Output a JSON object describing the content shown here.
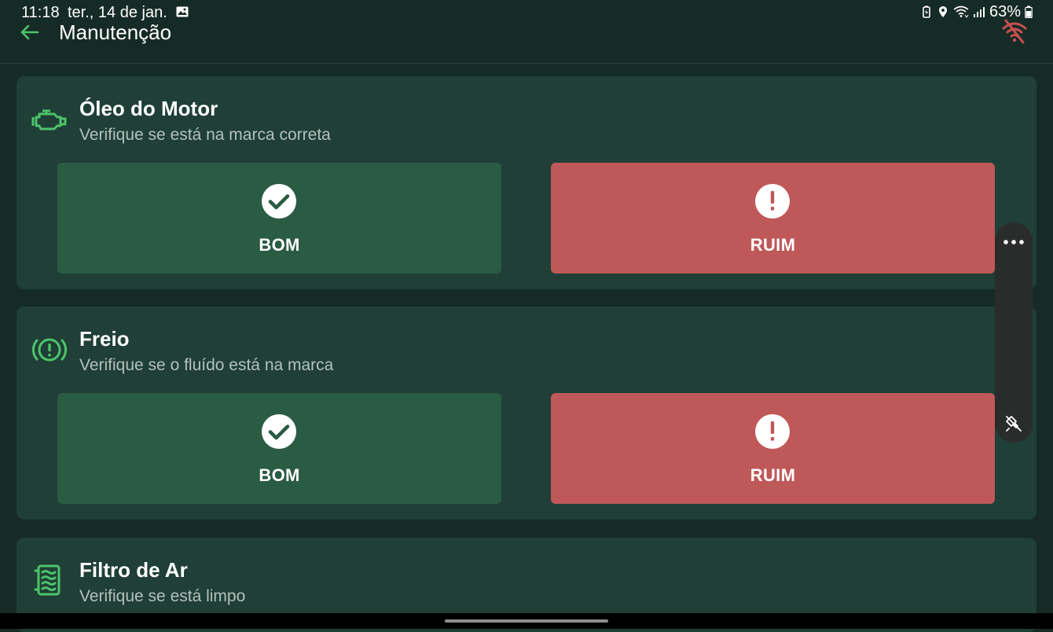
{
  "status_bar": {
    "time": "11:18",
    "date": "ter., 14 de jan.",
    "battery_percent": "63%",
    "icons": [
      "gallery-icon",
      "battery-saver-icon",
      "location-icon",
      "wifi-icon",
      "signal-icon",
      "battery-icon"
    ]
  },
  "app_bar": {
    "title": "Manutenção",
    "back_icon": "arrow-left-icon",
    "status_icon": "wifi-off-icon"
  },
  "colors": {
    "background": "#162b26",
    "card": "#1f3f37",
    "accent_green": "#4cc46a",
    "good_button": "#2a5b43",
    "bad_button": "#bf5858",
    "offline_icon": "#c85050"
  },
  "checklist": [
    {
      "icon": "engine-icon",
      "title": "Óleo do Motor",
      "subtitle": "Verifique se está na marca correta",
      "good_label": "BOM",
      "bad_label": "RUIM"
    },
    {
      "icon": "brake-warning-icon",
      "title": "Freio",
      "subtitle": "Verifique se o fluído está na marca",
      "good_label": "BOM",
      "bad_label": "RUIM"
    },
    {
      "icon": "air-filter-icon",
      "title": "Filtro de Ar",
      "subtitle": "Verifique se está limpo"
    }
  ],
  "side_panel": {
    "more_icon": "more-horizontal-icon",
    "unpin_icon": "unpin-icon"
  }
}
